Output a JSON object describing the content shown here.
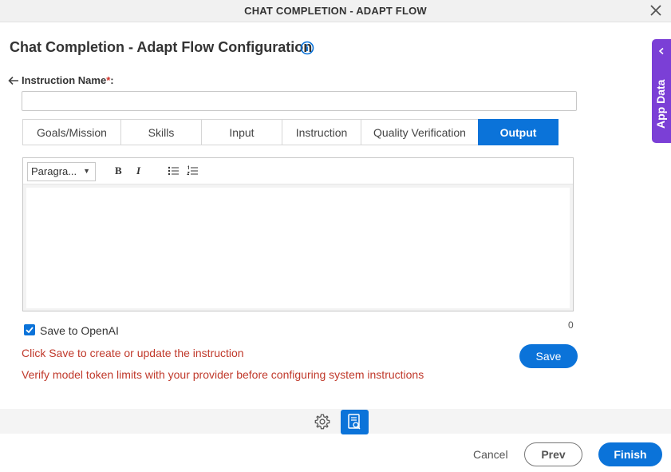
{
  "window": {
    "title": "CHAT COMPLETION - ADAPT FLOW",
    "close_icon": "close-icon"
  },
  "header": {
    "title": "Chat Completion - Adapt Flow Configuration",
    "info_icon": "info-icon"
  },
  "form": {
    "instruction_name_label": "Instruction Name",
    "required_mark": "*",
    "label_colon": ":",
    "instruction_name_value": "",
    "instruction_name_placeholder": ""
  },
  "tabs": [
    {
      "label": "Goals/Mission",
      "active": false
    },
    {
      "label": "Skills",
      "active": false
    },
    {
      "label": "Input",
      "active": false
    },
    {
      "label": "Instruction",
      "active": false
    },
    {
      "label": "Quality Verification",
      "active": false
    },
    {
      "label": "Output",
      "active": true
    }
  ],
  "editor": {
    "paragraph_select": "Paragra...",
    "bold": "B",
    "italic": "I",
    "content": ""
  },
  "save_to_openai": {
    "label": "Save to OpenAI",
    "checked": true
  },
  "char_count": "0",
  "messages": {
    "save_hint": "Click Save to create or update the instruction",
    "token_warning": "Verify model token limits with your provider before configuring system instructions"
  },
  "buttons": {
    "save": "Save",
    "cancel": "Cancel",
    "prev": "Prev",
    "finish": "Finish"
  },
  "side_panel": {
    "label": "App Data"
  },
  "colors": {
    "primary": "#0b73d9",
    "side_panel": "#7b3fd6",
    "error_text": "#c0392b"
  }
}
